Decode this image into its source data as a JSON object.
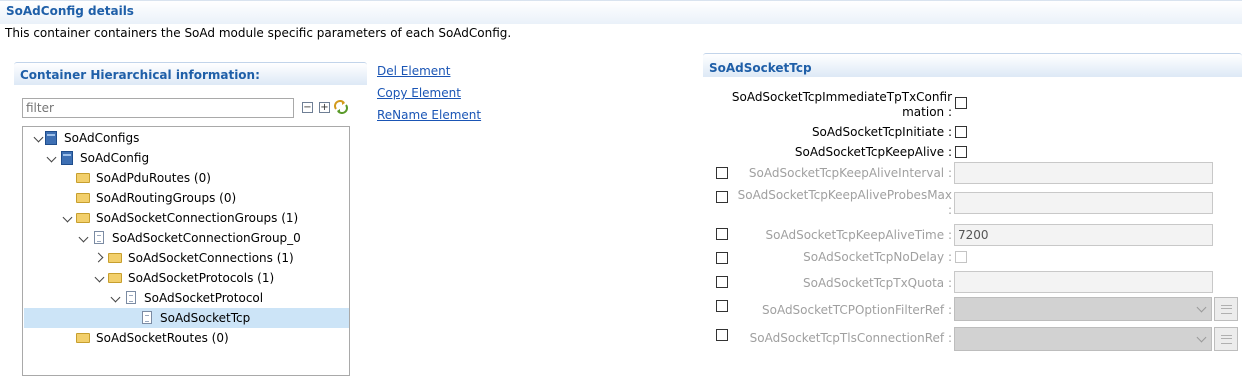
{
  "page": {
    "title": "SoAdConfig details",
    "description": "This container containers the SoAd module specific parameters of each SoAdConfig."
  },
  "left_panel": {
    "title": "Container Hierarchical information:",
    "filter_placeholder": "filter",
    "collapse_icon": "collapse-all-icon",
    "expand_icon": "expand-all-icon",
    "sync_icon": "link-with-editor-icon"
  },
  "tree": [
    {
      "label": "SoAdConfigs",
      "icon": "module-icon",
      "expanded": true
    },
    {
      "label": "SoAdConfig",
      "icon": "module-icon",
      "expanded": true
    },
    {
      "label": "SoAdPduRoutes (0)",
      "icon": "folder-icon"
    },
    {
      "label": "SoAdRoutingGroups (0)",
      "icon": "folder-icon"
    },
    {
      "label": "SoAdSocketConnectionGroups (1)",
      "icon": "folder-icon",
      "expanded": true
    },
    {
      "label": "SoAdSocketConnectionGroup_0",
      "icon": "document-icon",
      "expanded": true
    },
    {
      "label": "SoAdSocketConnections (1)",
      "icon": "folder-icon",
      "expanded": false
    },
    {
      "label": "SoAdSocketProtocols (1)",
      "icon": "folder-icon",
      "expanded": true
    },
    {
      "label": "SoAdSocketProtocol",
      "icon": "document-icon",
      "expanded": true
    },
    {
      "label": "SoAdSocketTcp",
      "icon": "document-icon",
      "selected": true
    },
    {
      "label": "SoAdSocketRoutes (0)",
      "icon": "folder-icon"
    }
  ],
  "actions": {
    "del": "Del Element",
    "copy": "Copy Element",
    "rename": "ReName Element"
  },
  "right_panel": {
    "title": "SoAdSocketTcp",
    "params": {
      "immediate_line1": "SoAdSocketTcpImmediateTpTxConfir",
      "immediate_line2": "mation :",
      "initiate": "SoAdSocketTcpInitiate :",
      "keepalive": "SoAdSocketTcpKeepAlive :",
      "keepalive_interval": "SoAdSocketTcpKeepAliveInterval :",
      "probes_line1": "SoAdSocketTcpKeepAliveProbesMax",
      "probes_line2": ":",
      "keepalive_time": "SoAdSocketTcpKeepAliveTime :",
      "keepalive_time_value": "7200",
      "nodelay": "SoAdSocketTcpNoDelay :",
      "txquota": "SoAdSocketTcpTxQuota :",
      "option_filter": "SoAdSocketTCPOptionFilterRef :",
      "tls": "SoAdSocketTcpTlsConnectionRef :"
    }
  }
}
